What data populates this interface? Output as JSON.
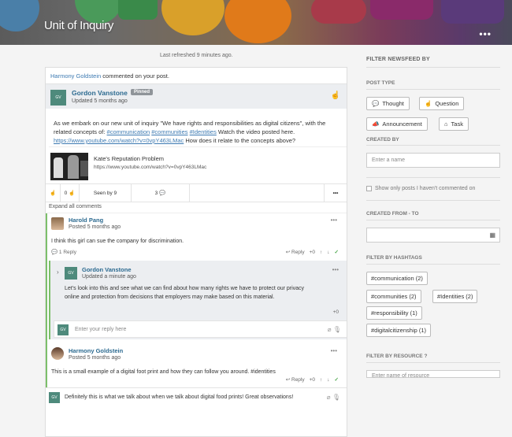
{
  "banner": {
    "title": "Unit of Inquiry",
    "more": "•••"
  },
  "feed": {
    "last_refreshed": "Last refreshed 9 minutes ago.",
    "notification": {
      "who": "Harmony Goldstein",
      "text": " commented on your post."
    },
    "post": {
      "avatar_initials": "GV",
      "author": "Gordon Vanstone",
      "pinned_label": "Pinned",
      "updated": "Updated 5 months ago",
      "body_1": "As we embark on our new unit of inquiry \"We have rights and responsibilities as digital citizens\", with the related concepts of: ",
      "tag_1": "#communication",
      "tag_2": "#communities",
      "tag_3": "#Identities",
      "body_2": " Watch the video posted here. ",
      "link": "https://www.youtube.com/watch?v=0vpY463LMac",
      "body_3": " How does it relate to the concepts above?",
      "card_title": "Kate's Reputation Problem",
      "card_url": "https://www.youtube.com/watch?v=0vpY463LMac",
      "actions": {
        "like_count": "0",
        "seen_by": "Seen by 9",
        "comment_count": "3",
        "more": "•••"
      }
    },
    "expand_all": "Expand all comments",
    "comments": [
      {
        "author": "Harold Pang",
        "time": "Posted 5 months ago",
        "text": "I think this girl can sue the company for discrimination.",
        "reply_count": "1 Reply",
        "reply_label": "Reply",
        "score": "+0"
      },
      {
        "avatar_initials": "GV",
        "author": "Gordon Vanstone",
        "time": "Updated a minute ago",
        "text": "Let's look into this and see what we can find about how many rights we have to protect our privacy online and protection from decisions that employers may make based on this material.",
        "score": "+0"
      },
      {
        "author": "Harmony Goldstein",
        "time": "Posted 5 months ago",
        "text": "This is a small example of a digital foot print and how they can follow you around. #identities",
        "reply_label": "Reply",
        "score": "+0"
      }
    ],
    "reply_placeholder": "Enter your reply here",
    "reply_avatar_initials": "GV",
    "draft_comment": "Definitely this is what we talk about when we talk about digital food prints! Great observations!"
  },
  "sidebar": {
    "heading": "FILTER NEWSFEED BY",
    "post_type_label": "POST TYPE",
    "post_types": [
      "Thought",
      "Question",
      "Announcement",
      "Task"
    ],
    "created_by_label": "CREATED BY",
    "created_by_placeholder": "Enter a name",
    "only_uncommented": "Show only posts I haven't commented on",
    "created_range_label": "CREATED FROM - TO",
    "hashtags_label": "FILTER BY HASHTAGS",
    "hashtags": [
      "#communication (2)",
      "#communities (2)",
      "#Identities (2)",
      "#responsibility (1)",
      "#digitalcitizenship (1)"
    ],
    "resource_label": "FILTER BY RESOURCE",
    "resource_placeholder": "Enter name of resource"
  }
}
